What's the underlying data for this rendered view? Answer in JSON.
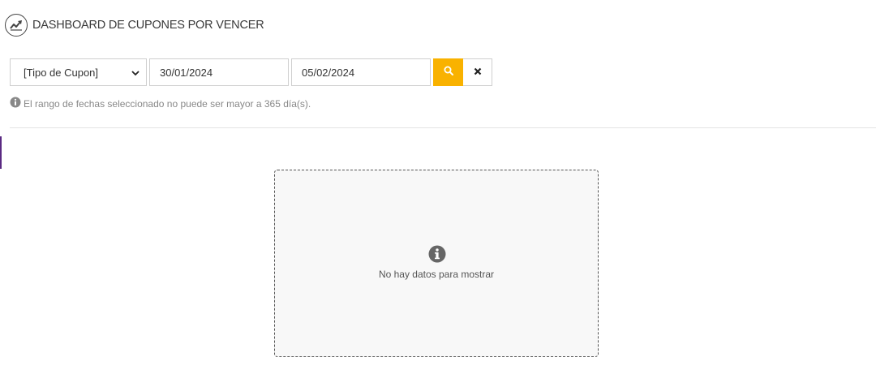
{
  "header": {
    "title": "DASHBOARD DE CUPONES POR VENCER",
    "icon": "trend-chart-icon"
  },
  "filters": {
    "coupon_type": {
      "selected": "[Tipo de Cupon]",
      "icon": "chevron-down-icon"
    },
    "start_date": "30/01/2024",
    "end_date": "05/02/2024",
    "search_icon": "search-icon",
    "clear_icon": "close-icon"
  },
  "hint": {
    "icon": "info-icon",
    "text": "El rango de fechas seleccionado no puede ser mayor a 365 día(s)."
  },
  "empty_state": {
    "icon": "info-icon",
    "message": "No hay datos para mostrar"
  },
  "colors": {
    "accent": "#f9b200",
    "side_accent": "#5a2a82",
    "text": "#444444"
  }
}
